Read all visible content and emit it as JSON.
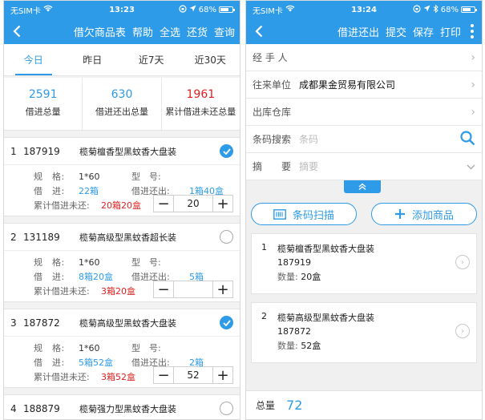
{
  "colors": {
    "accent": "#2e9be8",
    "alert": "#e02020"
  },
  "left": {
    "status": {
      "carrier": "无SIM卡",
      "time": "13:23",
      "battery": "68%",
      "battery_level": 0.68
    },
    "nav": {
      "actions": [
        "借欠商品表",
        "帮助",
        "全选",
        "还货",
        "查询"
      ]
    },
    "tabs": [
      "今日",
      "昨日",
      "近7天",
      "近30天"
    ],
    "active_tab": 0,
    "summary": [
      {
        "value": "2591",
        "label": "借进总量",
        "tone": "blue"
      },
      {
        "value": "630",
        "label": "借进还出总量",
        "tone": "blue"
      },
      {
        "value": "1961",
        "label": "累计借进未还总量",
        "tone": "red"
      }
    ],
    "field_labels": {
      "spec": "规　格:",
      "model": "型　号:",
      "borrowed": "借　进:",
      "returned": "借进还出:",
      "outstanding": "累计借进未还:"
    },
    "items": [
      {
        "index": "1",
        "code": "187919",
        "name": "榄菊檀香型黑蚊香大盘装",
        "checked": true,
        "spec": "1*60",
        "model": "",
        "borrowed": "22箱",
        "returned": "1箱40盒",
        "outstanding": "20箱20盒",
        "qty": "20"
      },
      {
        "index": "2",
        "code": "131189",
        "name": "榄菊高级型黑蚊香超长装",
        "checked": false,
        "spec": "1*60",
        "model": "",
        "borrowed": "8箱20盒",
        "returned": "5箱",
        "outstanding": "3箱20盒",
        "qty": ""
      },
      {
        "index": "3",
        "code": "187872",
        "name": "榄菊高级型黑蚊香大盘装",
        "checked": true,
        "spec": "1*60",
        "model": "",
        "borrowed": "5箱52盒",
        "returned": "2箱",
        "outstanding": "3箱52盒",
        "qty": "52"
      },
      {
        "index": "4",
        "code": "188879",
        "name": "榄菊强力型黑蚊香大盘装",
        "checked": false
      }
    ]
  },
  "right": {
    "status": {
      "carrier": "无SIM卡",
      "time": "13:24",
      "battery": "68%",
      "battery_level": 0.68
    },
    "nav": {
      "actions": [
        "借进还出",
        "提交",
        "保存",
        "打印"
      ]
    },
    "form": {
      "handler_label": "经 手 人",
      "handler_value": "",
      "partner_label": "往来单位",
      "partner_value": "成都果金贸易有限公司",
      "warehouse_label": "出库仓库",
      "warehouse_value": "",
      "barcode_label": "条码搜索",
      "barcode_placeholder": "条码",
      "summary_label": "摘　　要",
      "summary_placeholder": "摘要"
    },
    "buttons": {
      "scan": "条码扫描",
      "add": "添加商品"
    },
    "items": [
      {
        "index": "1",
        "name": "榄菊檀香型黑蚊香大盘装",
        "code": "187919",
        "qty_label": "数量:",
        "qty": "20盒"
      },
      {
        "index": "2",
        "name": "榄菊高级型黑蚊香大盘装",
        "code": "187872",
        "qty_label": "数量:",
        "qty": "52盒"
      }
    ],
    "footer": {
      "label": "总量",
      "value": "72"
    }
  }
}
